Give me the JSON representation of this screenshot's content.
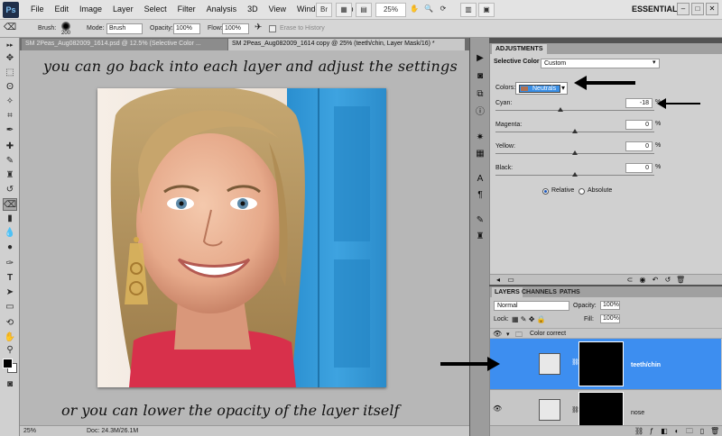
{
  "app": {
    "logo": "Ps",
    "menus": [
      "File",
      "Edit",
      "Image",
      "Layer",
      "Select",
      "Filter",
      "Analysis",
      "3D",
      "View",
      "Window",
      "Help"
    ],
    "bridge_button": "Br",
    "zoom_level": "25%",
    "workspace": "ESSENTIALS"
  },
  "options": {
    "brush_label": "Brush:",
    "brush_size": "200",
    "mode_label": "Mode:",
    "mode_value": "Brush",
    "opacity_label": "Opacity:",
    "opacity_value": "100%",
    "flow_label": "Flow:",
    "flow_value": "100%",
    "erase_history": "Erase to History"
  },
  "tabs": [
    {
      "label": "SM 2Peas_Aug082009_1614.psd @ 12.5% (Selective Color ..."
    },
    {
      "label": "SM 2Peas_Aug082009_1614 copy @ 25% (teeth/chin, Layer Mask/16) *"
    }
  ],
  "canvas": {
    "note_top": "you can go back into each layer and adjust the settings",
    "note_bottom": "or you can lower the opacity of the layer itself"
  },
  "status": {
    "zoom": "25%",
    "doc": "Doc: 24.3M/26.1M"
  },
  "adjustments": {
    "tab": "ADJUSTMENTS",
    "title": "Selective Color",
    "preset": "Custom",
    "colors_label": "Colors:",
    "colors_value": "Neutrals",
    "cyan_label": "Cyan:",
    "cyan_value": "-18",
    "magenta_label": "Magenta:",
    "magenta_value": "0",
    "yellow_label": "Yellow:",
    "yellow_value": "0",
    "black_label": "Black:",
    "black_value": "0",
    "percent": "%",
    "relative_label": "Relative",
    "absolute_label": "Absolute",
    "mode_selected": "Relative",
    "slider_levels": {
      "cyan": -18,
      "magenta": 0,
      "yellow": 0,
      "black": 0
    }
  },
  "layers": {
    "tabs": [
      "LAYERS",
      "CHANNELS",
      "PATHS"
    ],
    "blend_mode": "Normal",
    "opacity_label": "Opacity:",
    "opacity_value": "100%",
    "lock_label": "Lock:",
    "fill_label": "Fill:",
    "fill_value": "100%",
    "group_name": "Color correct",
    "items": [
      {
        "name": "teeth/chin",
        "selected": true
      },
      {
        "name": "nose",
        "selected": false
      }
    ]
  },
  "colors": {
    "accent": "#3d8ef0",
    "panel": "#d0d0d0",
    "canvas_bg": "#b7b7b7"
  }
}
